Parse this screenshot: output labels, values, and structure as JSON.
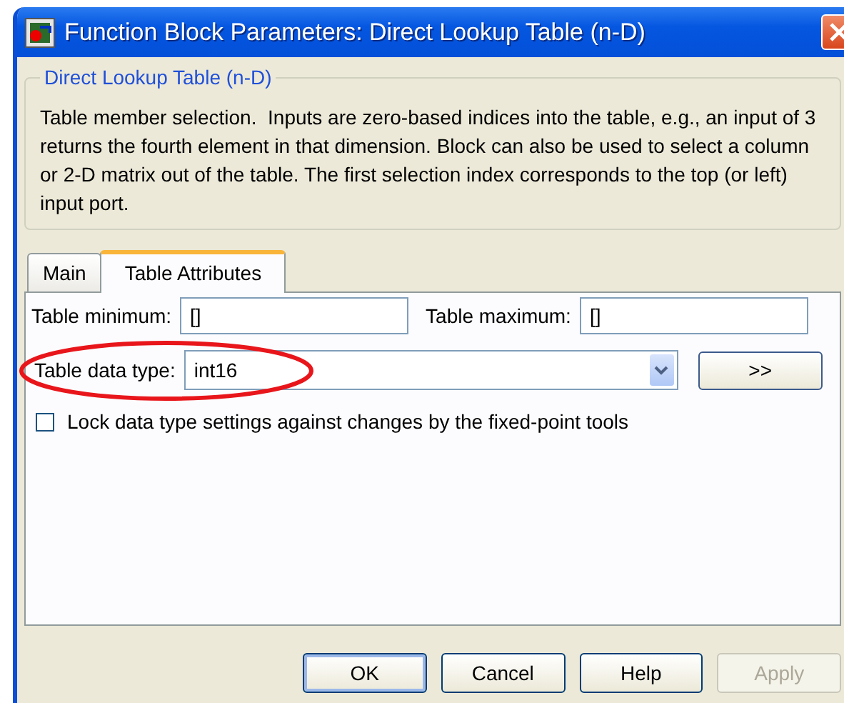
{
  "window": {
    "title": "Function Block Parameters: Direct Lookup Table (n-D)"
  },
  "group": {
    "title": "Direct Lookup Table (n-D)",
    "description": "Table member selection.  Inputs are zero-based indices into the table, e.g., an input of 3 returns the fourth element in that dimension. Block can also be used to select a column or 2-D matrix out of the table. The first selection index corresponds to the top (or left) input port."
  },
  "tabs": [
    {
      "label": "Main",
      "selected": false
    },
    {
      "label": "Table Attributes",
      "selected": true
    }
  ],
  "fields": [
    {
      "label": "Table minimum:",
      "value": "[]"
    },
    {
      "label": "Table maximum:",
      "value": "[]"
    }
  ],
  "data_type": {
    "label": "Table data type:",
    "value": "int16",
    "highlighted": true
  },
  "assistant_button": ">>",
  "checkbox": {
    "label": "Lock data type settings against changes by the fixed-point tools",
    "checked": false
  },
  "buttons": [
    {
      "label": "OK",
      "default": true,
      "disabled": false
    },
    {
      "label": "Cancel",
      "default": false,
      "disabled": false
    },
    {
      "label": "Help",
      "default": false,
      "disabled": false
    },
    {
      "label": "Apply",
      "default": false,
      "disabled": true
    }
  ]
}
